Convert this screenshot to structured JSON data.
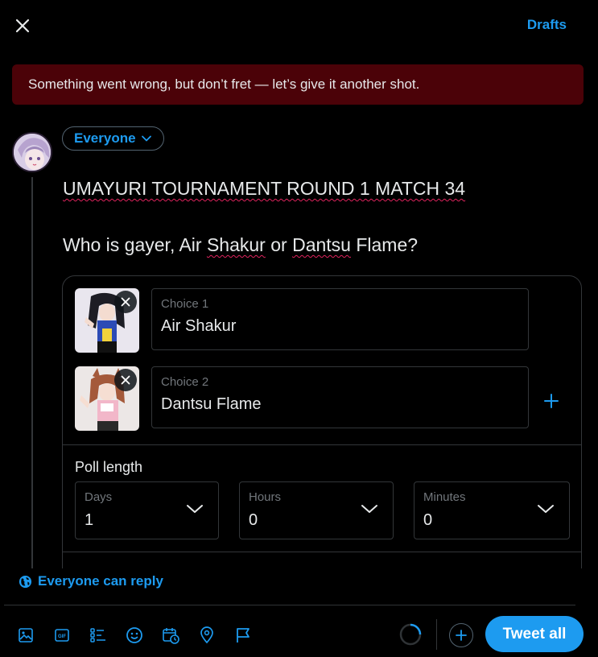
{
  "header": {
    "close_label": "Close",
    "drafts_label": "Drafts"
  },
  "error_banner": {
    "text": "Something went wrong, but don’t fret — let’s give it another shot."
  },
  "composer": {
    "audience_label": "Everyone",
    "text_line_1": "UMAYURI TOURNAMENT ROUND 1 MATCH 34",
    "text_line_2_parts": [
      "Who is gayer, Air ",
      "Shakur",
      " or ",
      "Dantsu",
      " Flame?"
    ]
  },
  "poll": {
    "choices": [
      {
        "label": "Choice 1",
        "value": "Air Shakur"
      },
      {
        "label": "Choice 2",
        "value": "Dantsu Flame"
      }
    ],
    "length_title": "Poll length",
    "days": {
      "label": "Days",
      "value": "1"
    },
    "hours": {
      "label": "Hours",
      "value": "0"
    },
    "minutes": {
      "label": "Minutes",
      "value": "0"
    }
  },
  "reply_setting": {
    "label": "Everyone can reply"
  },
  "toolbar": {
    "icons": [
      "media-icon",
      "gif-icon",
      "poll-icon",
      "emoji-icon",
      "schedule-icon",
      "location-icon",
      "flag-icon"
    ],
    "tweet_all_label": "Tweet all"
  },
  "colors": {
    "accent": "#1d9bf0",
    "error_bg": "#4b0208",
    "background": "#000000",
    "border": "#333639"
  }
}
